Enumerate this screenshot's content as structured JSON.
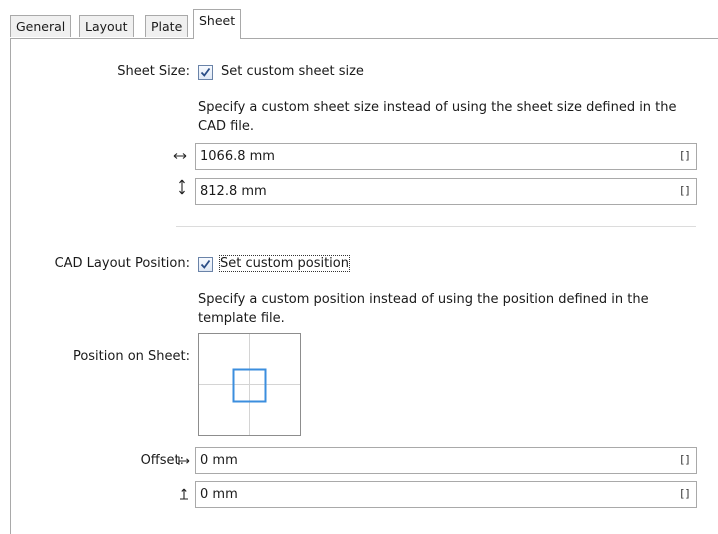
{
  "tabs": [
    {
      "label": "General"
    },
    {
      "label": "Layout"
    },
    {
      "label": "Plate"
    },
    {
      "label": "Sheet",
      "active": true
    }
  ],
  "sheet_size": {
    "label": "Sheet Size:",
    "checkbox_label": "Set custom sheet size",
    "checked": true,
    "description": "Specify a custom sheet size instead of using the sheet size defined in the CAD file.",
    "width_value": "1066.8 mm",
    "height_value": "812.8 mm",
    "width_icon": "horizontal-dimension-icon",
    "height_icon": "vertical-dimension-icon"
  },
  "cad_layout": {
    "label": "CAD Layout Position:",
    "checkbox_label": "Set custom position",
    "checked": true,
    "description": "Specify a custom position instead of using the position defined in the template file.",
    "position_label": "Position on Sheet:",
    "offset_label": "Offset:",
    "offset_x_value": "0 mm",
    "offset_y_value": "0 mm",
    "offset_x_icon": "horizontal-offset-icon",
    "offset_y_icon": "vertical-offset-icon"
  },
  "unit_button_text": "[]",
  "colors": {
    "accent": "#3b8ede",
    "border": "#a9a9a9",
    "check": "#2a4d86"
  }
}
